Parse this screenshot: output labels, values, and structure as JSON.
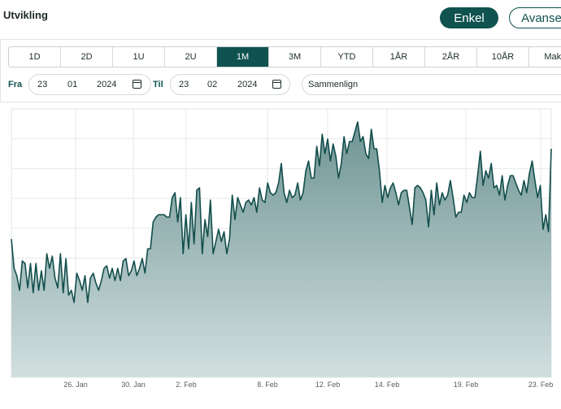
{
  "header": {
    "title": "Utvikling",
    "mode_simple": "Enkel",
    "mode_advanced": "Avanse"
  },
  "range_tabs": [
    "1D",
    "2D",
    "1U",
    "2U",
    "1M",
    "3M",
    "YTD",
    "1ÅR",
    "2ÅR",
    "10ÅR",
    "Maks"
  ],
  "active_range": "1M",
  "date_from": {
    "label": "Fra",
    "day": "23",
    "month": "01",
    "year": "2024"
  },
  "date_to": {
    "label": "Til",
    "day": "23",
    "month": "02",
    "year": "2024"
  },
  "compare": {
    "placeholder": "Sammenlign"
  },
  "colors": {
    "accent": "#10524f",
    "line": "#124e4c",
    "fill_top": "#6f9594",
    "fill_bottom": "#d2dfdf"
  },
  "chart_data": {
    "type": "area",
    "grid": true,
    "x_ticks": [
      "26. Jan",
      "30. Jan",
      "2. Feb",
      "8. Feb",
      "12. Feb",
      "14. Feb",
      "19. Feb",
      "23. Feb"
    ],
    "series": [
      {
        "values": [
          52,
          40,
          37,
          31,
          43,
          42,
          32,
          42,
          30,
          42,
          31,
          39,
          31,
          46,
          40,
          45,
          36,
          32,
          46,
          30,
          44,
          29,
          31,
          26,
          38,
          35,
          31,
          37,
          26,
          36,
          38,
          34,
          31,
          35,
          40,
          41,
          36,
          40,
          35,
          40,
          35,
          43,
          44,
          37,
          39,
          43,
          37,
          40,
          44,
          38,
          48,
          48,
          59,
          61,
          62,
          62,
          62,
          61,
          61,
          69,
          71,
          59,
          69,
          46,
          62,
          48,
          67,
          50,
          72,
          73,
          46,
          60,
          53,
          68,
          46,
          51,
          56,
          51,
          55,
          46,
          52,
          70,
          60,
          69,
          66,
          63,
          67,
          68,
          66,
          69,
          63,
          73,
          68,
          67,
          75,
          71,
          70,
          71,
          75,
          83,
          71,
          67,
          72,
          69,
          70,
          75,
          68,
          71,
          80,
          84,
          77,
          77,
          90,
          82,
          95,
          87,
          93,
          84,
          91,
          86,
          77,
          83,
          94,
          87,
          92,
          92,
          96,
          100,
          92,
          94,
          87,
          85,
          97,
          89,
          89,
          80,
          67,
          74,
          69,
          73,
          75,
          71,
          66,
          71,
          72,
          72,
          65,
          58,
          73,
          74,
          73,
          71,
          68,
          57,
          72,
          62,
          75,
          66,
          71,
          68,
          70,
          76,
          69,
          61,
          63,
          63,
          70,
          67,
          71,
          69,
          69,
          78,
          88,
          74,
          80,
          77,
          83,
          73,
          74,
          70,
          78,
          68,
          74,
          78,
          78,
          75,
          72,
          70,
          76,
          71,
          79,
          84,
          76,
          69,
          74,
          56,
          62,
          55,
          89
        ]
      }
    ]
  }
}
